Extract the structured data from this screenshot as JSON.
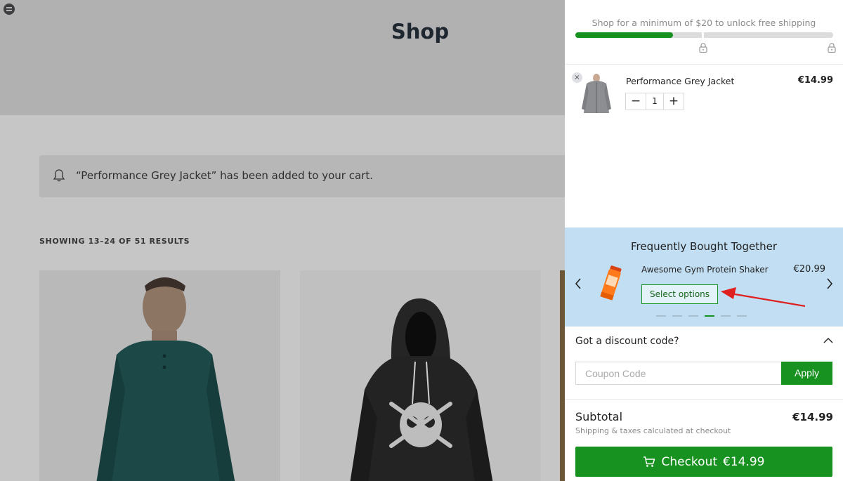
{
  "shop": {
    "title": "Shop",
    "notice": "“Performance Grey Jacket” has been added to your cart.",
    "results": "SHOWING 13–24 OF 51 RESULTS"
  },
  "shipping": {
    "message": "Shop for a minimum of $20 to unlock free shipping",
    "progress": 0.38
  },
  "cart_item": {
    "name": "Performance Grey Jacket",
    "price": "€14.99",
    "quantity": "1",
    "minus": "−",
    "plus": "+",
    "remove": "×"
  },
  "fbt": {
    "title": "Frequently Bought Together",
    "product_name": "Awesome Gym Protein Shaker",
    "product_price": "€20.99",
    "select_label": "Select options",
    "active_dot": 3
  },
  "discount": {
    "title": "Got a discount code?",
    "placeholder": "Coupon Code",
    "value": "",
    "apply_label": "Apply"
  },
  "summary": {
    "subtotal_label": "Subtotal",
    "subtotal_value": "€14.99",
    "shipping_note": "Shipping & taxes calculated at checkout",
    "checkout_label": "Checkout",
    "checkout_total": "€14.99"
  },
  "colors": {
    "accent_green": "#17911f",
    "fbt_background": "#c2def3",
    "annotation_red": "#e0201e"
  }
}
